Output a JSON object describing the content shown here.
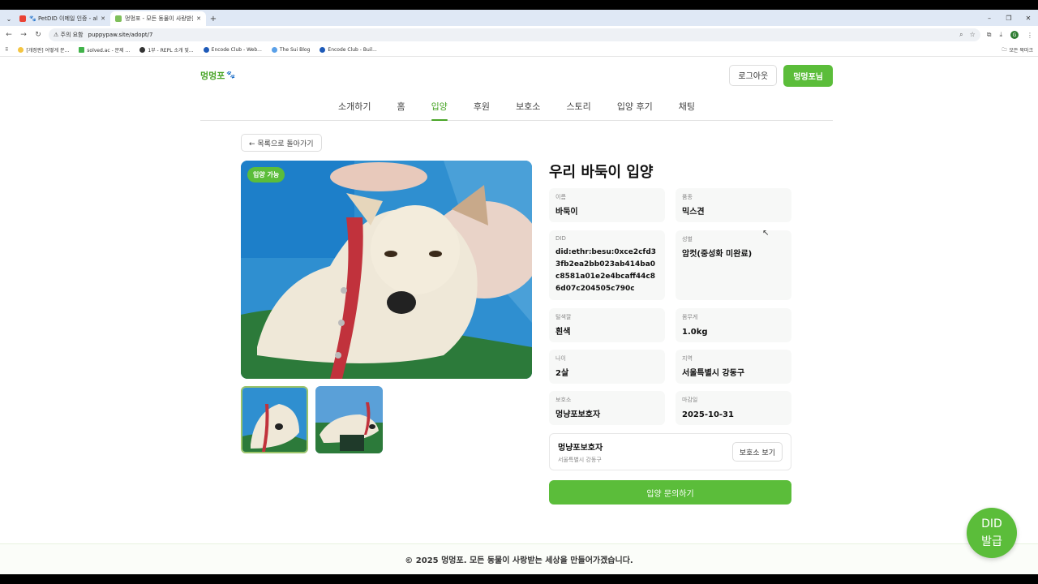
{
  "browser": {
    "tabs": [
      {
        "title": "🐾 PetDID 이메일 인증 - ahuh"
      },
      {
        "title": "멍멍포 - 모든 동물이 사랑받는"
      }
    ],
    "url_warning": "주의 요함",
    "url": "puppypaw.site/adopt/7",
    "bookmarks": [
      "[개정판] 어떻게 문...",
      "solved.ac - 문제 ...",
      "1부 - REPL 소개 및...",
      "Encode Club - Web...",
      "The Sui Blog",
      "Encode Club - Buil..."
    ],
    "bookmarks_all": "모든 북마크"
  },
  "header": {
    "logo": "멍멍포",
    "logout": "로그아웃",
    "user": "멍멍포님"
  },
  "nav": [
    {
      "label": "소개하기"
    },
    {
      "label": "홈"
    },
    {
      "label": "입양"
    },
    {
      "label": "후원"
    },
    {
      "label": "보호소"
    },
    {
      "label": "스토리"
    },
    {
      "label": "입양 후기"
    },
    {
      "label": "채팅"
    }
  ],
  "back_label": "← 목록으로 돌아가기",
  "badge": "입양 가능",
  "title": "우리 바둑이 입양",
  "fields": {
    "name": {
      "label": "이름",
      "value": "바둑이"
    },
    "breed": {
      "label": "품종",
      "value": "믹스견"
    },
    "did": {
      "label": "DID",
      "value": "did:ethr:besu:0xce2cfd33fb2ea2bb023ab414ba0c8581a01e2e4bcaff44c86d07c204505c790c"
    },
    "gender": {
      "label": "성별",
      "value": "암컷(중성화 미완료)"
    },
    "color": {
      "label": "털색깔",
      "value": "흰색"
    },
    "weight": {
      "label": "몸무게",
      "value": "1.0kg"
    },
    "age": {
      "label": "나이",
      "value": "2살"
    },
    "region": {
      "label": "지역",
      "value": "서울특별시 강동구"
    },
    "shelter": {
      "label": "보호소",
      "value": "멍냥포보호자"
    },
    "deadline": {
      "label": "마감일",
      "value": "2025-10-31"
    }
  },
  "shelter_card": {
    "name": "멍냥포보호자",
    "address": "서울특별시 강동구",
    "button": "보호소 보기"
  },
  "inquiry": "입양 문의하기",
  "footer": "© 2025 멍멍포. 모든 동물이 사랑받는 세상을 만들어가겠습니다.",
  "did_fab": {
    "line1": "DID",
    "line2": "발급"
  }
}
